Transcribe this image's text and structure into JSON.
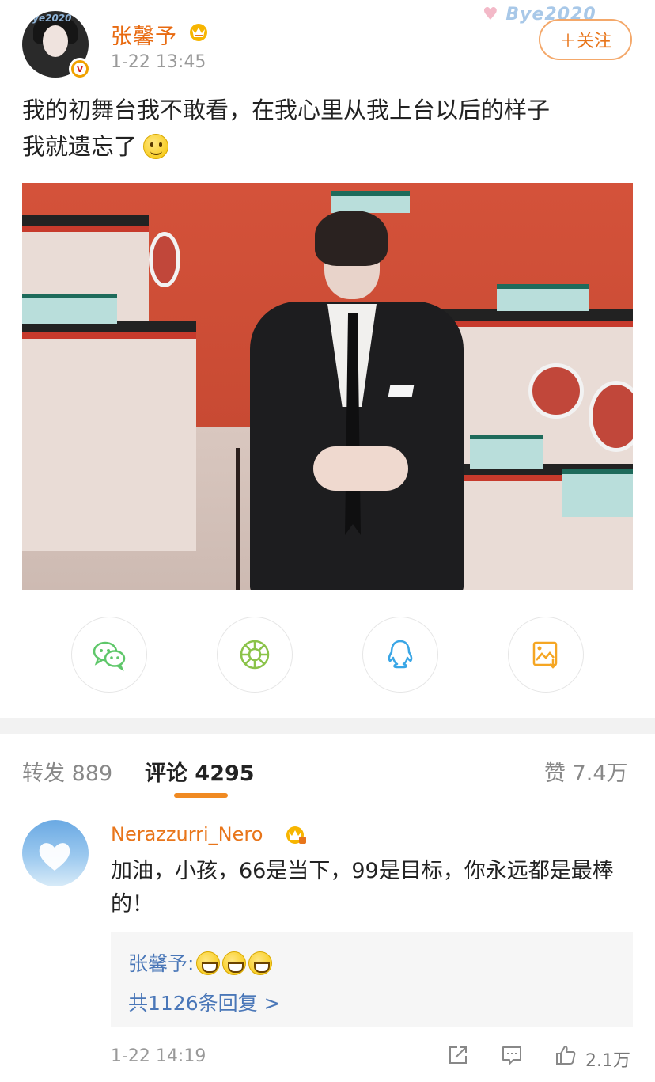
{
  "post": {
    "username": "张馨予",
    "time": "1-22 13:45",
    "follow_label": "＋关注",
    "header_decoration": "Bye2020",
    "text_line1": "我的初舞台我不敢看，在我心里从我上台以后的样子",
    "text_line2": "我就遗忘了",
    "verified_badge": "V"
  },
  "share": {
    "icons": [
      "wechat-icon",
      "moments-icon",
      "qq-icon",
      "save-image-icon"
    ]
  },
  "tabs": {
    "repost_label": "转发",
    "repost_count": "889",
    "comment_label": "评论",
    "comment_count": "4295",
    "like_label": "赞",
    "like_count": "7.4万"
  },
  "comment": {
    "username": "Nerazzurri_Nero",
    "text": "加油，小孩，66是当下，99是目标，你永远都是最棒的！",
    "reply_author": "张馨予:",
    "reply_more": "共1126条回复 >",
    "time": "1-22 14:19",
    "like_count": "2.1万"
  },
  "colors": {
    "accent": "#e8751a",
    "link": "#4a77b8",
    "tab_underline": "#f08a22"
  }
}
